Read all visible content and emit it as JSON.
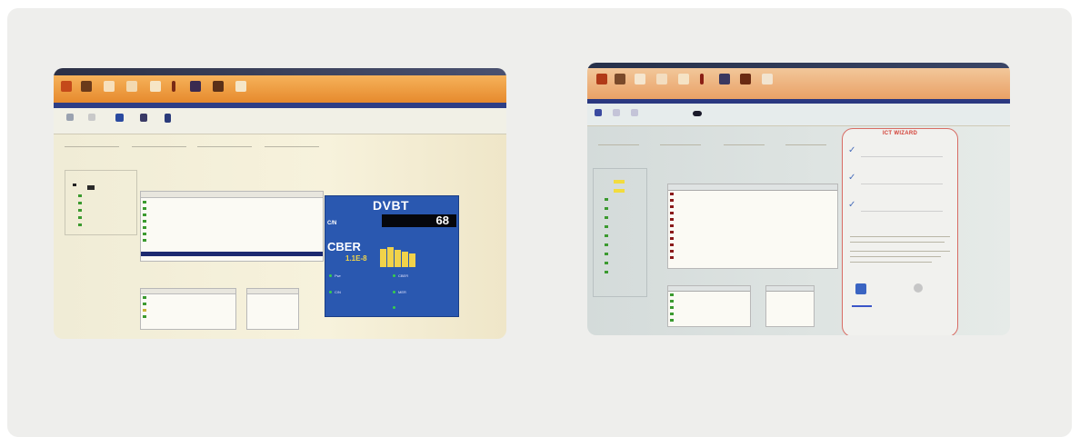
{
  "photos": [
    {
      "name": "left-screenshot",
      "dvbt_panel": {
        "title": "DVBT",
        "cn_label": "C/N",
        "cn_value": "68",
        "cber_label": "CBER",
        "cber_value": "1.1E-8",
        "measure_labels": [
          "Pwr",
          "C/N",
          "CBER",
          "MER"
        ],
        "yellow_bars": [
          0.85,
          0.92,
          0.78,
          0.7,
          0.64
        ]
      },
      "colors": {
        "toolbar": "#e68a2d",
        "panel": "#2a58b0",
        "accent": "#f1d24a"
      }
    },
    {
      "name": "right-screenshot",
      "wizard": {
        "title": "ICT WIZARD"
      },
      "colors": {
        "toolbar": "#e68a2d",
        "wizard_border": "#d86c64",
        "title": "#d34036"
      }
    }
  ]
}
